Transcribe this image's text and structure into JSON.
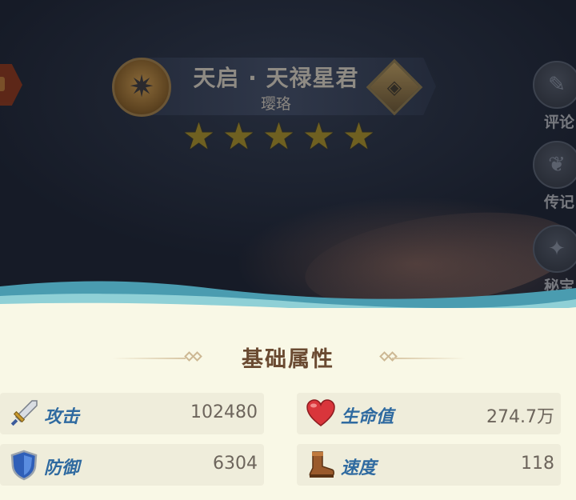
{
  "hero": {
    "title": "天启 · 天禄星君",
    "subtitle": "璎珞",
    "stars": 5
  },
  "side_buttons": [
    {
      "label": "评论",
      "icon": "comment-icon"
    },
    {
      "label": "传记",
      "icon": "book-icon"
    },
    {
      "label": "秘宝",
      "icon": "treasure-icon"
    }
  ],
  "attributes": {
    "title": "基础属性",
    "stats": [
      {
        "name": "攻击",
        "value": "102480",
        "icon": "sword-icon"
      },
      {
        "name": "生命值",
        "value": "274.7万",
        "icon": "heart-icon"
      },
      {
        "name": "防御",
        "value": "6304",
        "icon": "shield-icon"
      },
      {
        "name": "速度",
        "value": "118",
        "icon": "boot-icon"
      }
    ]
  },
  "colors": {
    "panel_bg": "#f9f8e6",
    "stat_name": "#2f6aa0",
    "section_title": "#6a4a31",
    "wave_teal": "#4a9cb0"
  }
}
